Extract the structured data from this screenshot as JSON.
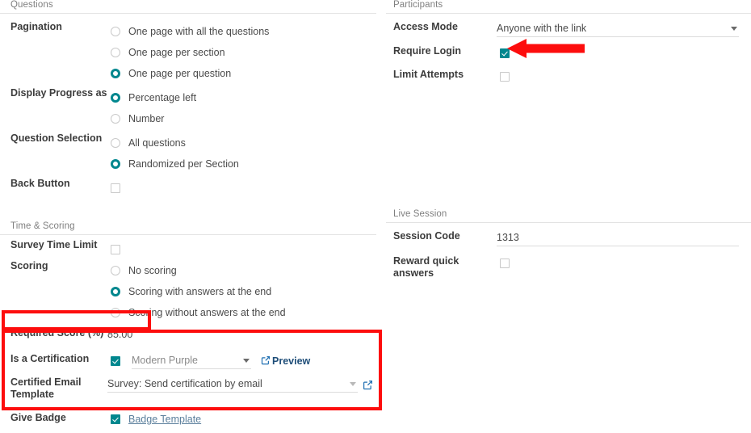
{
  "left_column": {
    "questions_group": {
      "title": "Questions",
      "rows": [
        {
          "label": "Pagination",
          "type": "radio",
          "options": [
            {
              "label": "One page with all the questions",
              "selected": false
            },
            {
              "label": "One page per section",
              "selected": false
            },
            {
              "label": "One page per question",
              "selected": true
            }
          ]
        },
        {
          "label": "Display Progress as",
          "type": "radio",
          "options": [
            {
              "label": "Percentage left",
              "selected": true
            },
            {
              "label": "Number",
              "selected": false
            }
          ]
        },
        {
          "label": "Question Selection",
          "type": "radio",
          "options": [
            {
              "label": "All questions",
              "selected": false
            },
            {
              "label": "Randomized per Section",
              "selected": true
            }
          ]
        },
        {
          "label": "Back Button",
          "type": "checkbox",
          "checked": false
        }
      ]
    },
    "time_scoring_group": {
      "title": "Time & Scoring",
      "rows": [
        {
          "label": "Survey Time Limit",
          "type": "checkbox",
          "checked": false
        },
        {
          "label": "Scoring",
          "type": "radio",
          "options": [
            {
              "label": "No scoring",
              "selected": false
            },
            {
              "label": "Scoring with answers at the end",
              "selected": true
            },
            {
              "label": "Scoring without answers at the end",
              "selected": false
            }
          ]
        },
        {
          "label": "Required Score (%)",
          "type": "text",
          "value": "85.00"
        },
        {
          "label": "Is a Certification",
          "type": "checkbox_select_link",
          "checked": true,
          "select_value": "Modern Purple",
          "link_label": "Preview",
          "link_icon": "external-link-icon"
        },
        {
          "label": "Certified Email Template",
          "type": "select_ext",
          "value": "Survey: Send certification by email",
          "ext_icon": "external-link-icon"
        },
        {
          "label": "Give Badge",
          "type": "checkbox_link",
          "checked": true,
          "link_label": "Badge Template"
        }
      ]
    }
  },
  "right_column": {
    "participants_group": {
      "title": "Participants",
      "rows": [
        {
          "label": "Access Mode",
          "type": "select",
          "value": "Anyone with the link"
        },
        {
          "label": "Require Login",
          "type": "checkbox",
          "checked": true
        },
        {
          "label": "Limit Attempts",
          "type": "checkbox",
          "checked": false
        }
      ]
    },
    "live_session_group": {
      "title": "Live Session",
      "rows": [
        {
          "label": "Session Code",
          "type": "text_underline",
          "value": "1313"
        },
        {
          "label": "Reward quick answers",
          "type": "checkbox",
          "checked": false
        }
      ]
    }
  },
  "annotations": {
    "color": "#fd0d0d",
    "highlight_required_score": "Required Score (%) row highlight",
    "highlight_certification": "Certification block highlight",
    "arrow_require_login": "arrow pointing to Require Login checkbox"
  }
}
